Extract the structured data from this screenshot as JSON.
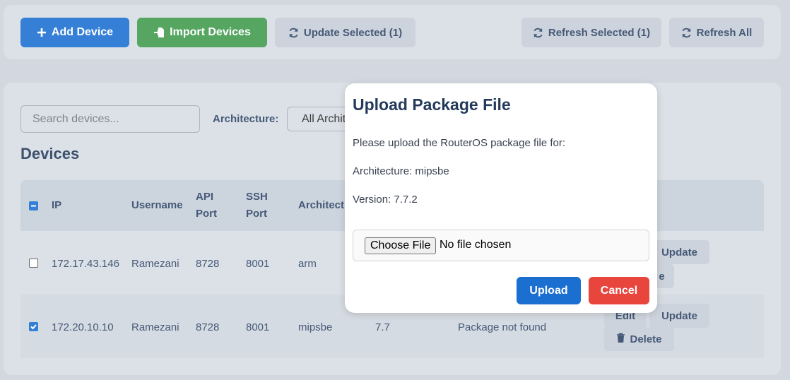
{
  "toolbar": {
    "add_device": "Add Device",
    "import_devices": "Import Devices",
    "update_selected": "Update Selected (1)",
    "refresh_selected": "Refresh Selected (1)",
    "refresh_all": "Refresh All"
  },
  "filters": {
    "search_placeholder": "Search devices...",
    "architecture_label": "Architecture:",
    "architecture_value": "All Archit"
  },
  "devices": {
    "title": "Devices",
    "columns": {
      "ip": "IP",
      "username": "Username",
      "api_port_1": "API",
      "api_port_2": "Port",
      "ssh_port_1": "SSH",
      "ssh_port_2": "Port",
      "architecture": "Architect"
    },
    "rows": [
      {
        "ip": "172.17.43.146",
        "username": "Ramezani",
        "api_port": "8728",
        "ssh_port": "8001",
        "arch": "arm",
        "checked": false,
        "update": "Update",
        "delete_partial": "e"
      },
      {
        "ip": "172.20.10.10",
        "username": "Ramezani",
        "api_port": "8728",
        "ssh_port": "8001",
        "arch": "mipsbe",
        "version": "7.7",
        "status": "Package not found",
        "checked": true,
        "edit": "Edit",
        "update": "Update",
        "delete": "Delete"
      }
    ]
  },
  "modal": {
    "title": "Upload Package File",
    "instruction": "Please upload the RouterOS package file for:",
    "architecture": "Architecture: mipsbe",
    "version": "Version: 7.7.2",
    "choose_file": "Choose File",
    "no_file": "No file chosen",
    "upload": "Upload",
    "cancel": "Cancel"
  },
  "colors": {
    "primary": "#1a6fd1",
    "success": "#3f9a4d",
    "danger": "#e8453c",
    "text_dark": "#233a5a"
  }
}
